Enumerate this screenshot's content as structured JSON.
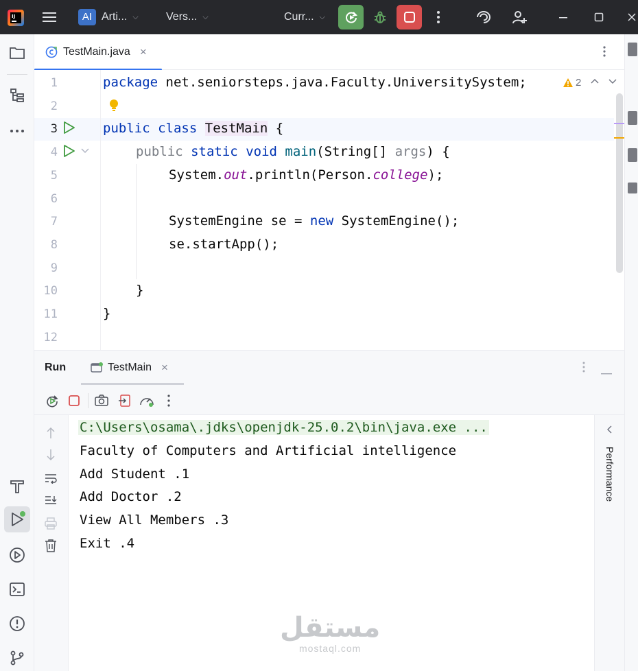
{
  "titlebar": {
    "project_badge": "AI",
    "project_name": "Arti...",
    "vcs_label": "Vers...",
    "run_config": "Curr...",
    "colors": {
      "bg": "#27282c",
      "rerun": "#5fa15f",
      "stop": "#d94f4f"
    }
  },
  "editor": {
    "tab": {
      "filename": "TestMain.java",
      "close": "×"
    },
    "warnings": {
      "count": "2"
    },
    "line_numbers": [
      "1",
      "2",
      "3",
      "4",
      "5",
      "6",
      "7",
      "8",
      "9",
      "10",
      "11",
      "12"
    ],
    "code": {
      "l1": {
        "kw": "package",
        "rest": " net.seniorsteps.java.Faculty.UniversitySystem;"
      },
      "l3": {
        "kw1": "public",
        "kw2": "class",
        "cls": "TestMain",
        "rest": " {"
      },
      "l4": {
        "kw1": "public",
        "kw2": "static",
        "kw3": "void",
        "name": "main",
        "p1": "(String[] ",
        "arg": "args",
        "p2": ") {"
      },
      "l5": {
        "a": "System.",
        "out": "out",
        "b": ".println(Person.",
        "fld": "college",
        "c": ");"
      },
      "l7": {
        "a": "SystemEngine se = ",
        "kw": "new",
        "b": " SystemEngine();"
      },
      "l8": {
        "a": "se.startApp();"
      },
      "l10": {
        "a": "}"
      },
      "l11": {
        "a": "}"
      }
    }
  },
  "run": {
    "title": "Run",
    "tab_label": "TestMain",
    "tab_close": "×",
    "console": [
      "C:\\Users\\osama\\.jdks\\openjdk-25.0.2\\bin\\java.exe ...",
      "Faculty of Computers and Artificial intelligence",
      "Add Student .1",
      "Add Doctor .2",
      "View All Members .3",
      "Exit .4"
    ],
    "side_panel": "Performance"
  },
  "watermark": {
    "arabic": "مستقل",
    "latin": "mostaql.com"
  }
}
